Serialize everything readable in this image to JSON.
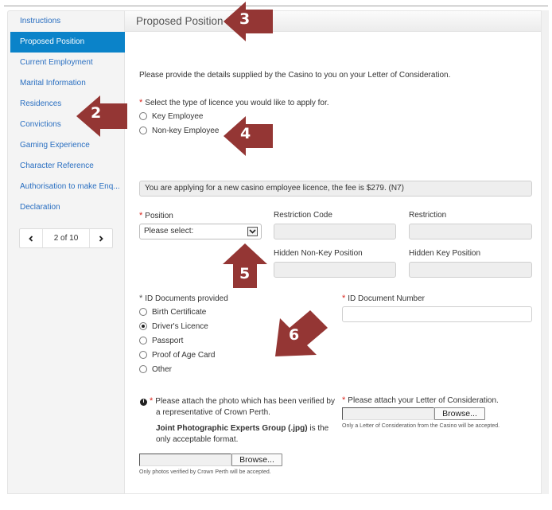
{
  "sidebar": {
    "items": [
      {
        "label": "Instructions",
        "active": false
      },
      {
        "label": "Proposed Position",
        "active": true
      },
      {
        "label": "Current Employment",
        "active": false
      },
      {
        "label": "Marital Information",
        "active": false
      },
      {
        "label": "Residences",
        "active": false
      },
      {
        "label": "Convictions",
        "active": false
      },
      {
        "label": "Gaming Experience",
        "active": false
      },
      {
        "label": "Character Reference",
        "active": false
      },
      {
        "label": "Authorisation to make Enq...",
        "active": false
      },
      {
        "label": "Declaration",
        "active": false
      }
    ],
    "pager": {
      "label": "2 of 10",
      "prev_icon": "chevron-left-icon",
      "next_icon": "chevron-right-icon"
    }
  },
  "panel": {
    "title": "Proposed Position",
    "intro": "Please provide the details supplied by the Casino to you on your Letter of Consideration.",
    "licence_type": {
      "required_mark": "*",
      "label": "Select the type of licence you would like to apply for.",
      "options": [
        {
          "label": "Key Employee",
          "checked": false
        },
        {
          "label": "Non-key Employee",
          "checked": false
        }
      ]
    },
    "fee_message": "You are applying for a new casino employee licence, the fee is $279. (N7)",
    "position": {
      "required_mark": "*",
      "label": "Position",
      "selected": "Please select:"
    },
    "restriction_code": {
      "label": "Restriction Code",
      "value": ""
    },
    "restriction": {
      "label": "Restriction",
      "value": ""
    },
    "hidden_non_key_position": {
      "label": "Hidden Non-Key Position",
      "value": ""
    },
    "hidden_key_position": {
      "label": "Hidden Key Position",
      "value": ""
    },
    "id_documents": {
      "required_mark": "*",
      "label": "ID Documents provided",
      "options": [
        {
          "label": "Birth Certificate",
          "checked": false
        },
        {
          "label": "Driver's Licence",
          "checked": true
        },
        {
          "label": "Passport",
          "checked": false
        },
        {
          "label": "Proof of Age Card",
          "checked": false
        },
        {
          "label": "Other",
          "checked": false
        }
      ]
    },
    "id_document_number": {
      "required_mark": "*",
      "label": "ID Document Number",
      "value": ""
    },
    "photo_upload": {
      "info_icon": "info-icon",
      "required_mark": "*",
      "label_line1": "Please attach the photo which has been verified by",
      "label_line2": "a representative of Crown Perth.",
      "format_bold": "Joint Photographic Experts Group (.jpg)",
      "format_rest1": " is the",
      "format_rest2": "only acceptable format.",
      "browse_label": "Browse...",
      "note": "Only photos verified by Crown Perth will be accepted."
    },
    "letter_upload": {
      "required_mark": "*",
      "label": "Please attach your Letter of Consideration.",
      "browse_label": "Browse...",
      "note": "Only a Letter of Consideration from the Casino will be accepted."
    }
  },
  "callouts": [
    {
      "number": "2",
      "direction": "left"
    },
    {
      "number": "3",
      "direction": "left"
    },
    {
      "number": "4",
      "direction": "left"
    },
    {
      "number": "5",
      "direction": "up"
    },
    {
      "number": "6",
      "direction": "down-left"
    }
  ],
  "colors": {
    "accent": "#0b83c9",
    "link": "#2a6fc1",
    "required": "#d9251d",
    "callout": "#943634"
  }
}
